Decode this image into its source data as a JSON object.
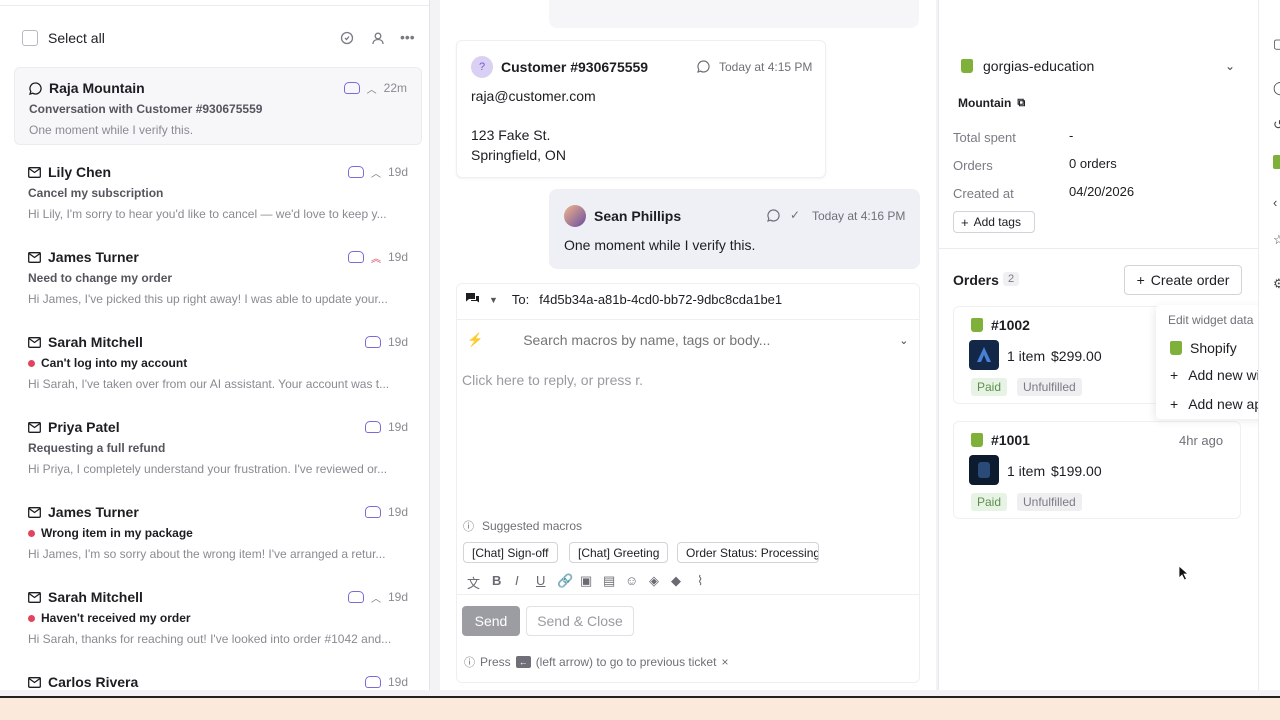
{
  "ticket_list": {
    "select_all_label": "Select all",
    "tickets": [
      {
        "name": "Raja Mountain",
        "subject": "Conversation with Customer #930675559",
        "preview": "One moment while I verify this.",
        "time": "22m",
        "urgent": false,
        "active": true,
        "channel": "chat",
        "priority": "up"
      },
      {
        "name": "Lily Chen",
        "subject": "Cancel my subscription",
        "preview": "Hi Lily, I'm sorry to hear you'd like to cancel — we'd love to keep y...",
        "time": "19d",
        "urgent": false,
        "channel": "email",
        "priority": "up"
      },
      {
        "name": "James Turner",
        "subject": "Need to change my order",
        "preview": "Hi James, I've picked this up right away! I was able to update your...",
        "time": "19d",
        "urgent": false,
        "channel": "email",
        "priority": "double-up"
      },
      {
        "name": "Sarah Mitchell",
        "subject": "Can't log into my account",
        "preview": "Hi Sarah, I've taken over from our AI assistant. Your account was t...",
        "time": "19d",
        "urgent": true,
        "channel": "email",
        "priority": ""
      },
      {
        "name": "Priya Patel",
        "subject": "Requesting a full refund",
        "preview": "Hi Priya, I completely understand your frustration. I've reviewed or...",
        "time": "19d",
        "urgent": false,
        "channel": "email",
        "priority": ""
      },
      {
        "name": "James Turner",
        "subject": "Wrong item in my package",
        "preview": "Hi James, I'm so sorry about the wrong item! I've arranged a retur...",
        "time": "19d",
        "urgent": true,
        "channel": "email",
        "priority": ""
      },
      {
        "name": "Sarah Mitchell",
        "subject": "Haven't received my order",
        "preview": "Hi Sarah, thanks for reaching out! I've looked into order #1042 and...",
        "time": "19d",
        "urgent": true,
        "channel": "email",
        "priority": "up"
      },
      {
        "name": "Carlos Rivera",
        "subject": "",
        "preview": "",
        "time": "19d",
        "urgent": false,
        "channel": "email",
        "priority": ""
      }
    ]
  },
  "conversation": {
    "customer_msg": {
      "avatar": "?",
      "sender": "Customer #930675559",
      "time": "Today at 4:15 PM",
      "line1": "raja@customer.com",
      "line2": "123 Fake St.",
      "line3": "Springfield, ON"
    },
    "agent_msg": {
      "sender": "Sean Phillips",
      "time": "Today at 4:16 PM",
      "text": "One moment while I verify this."
    }
  },
  "composer": {
    "to_label": "To:",
    "to_value": "f4d5b34a-a81b-4cd0-bb72-9dbc8cda1be1",
    "macro_placeholder": "Search macros by name, tags or body...",
    "reply_placeholder": "Click here to reply, or press r.",
    "suggested_label": "Suggested macros",
    "macros": [
      "[Chat] Sign-off",
      "[Chat] Greeting",
      "Order Status: Processing"
    ],
    "send_label": "Send",
    "send_close_label": "Send & Close",
    "hint_prefix": "Press",
    "hint_key": "←",
    "hint_suffix": "(left arrow) to go to previous ticket",
    "hint_close": "×"
  },
  "sidebar": {
    "store": "gorgias-education",
    "customer_name": "Mountain",
    "total_spent_label": "Total spent",
    "total_spent_value": "-",
    "orders_label": "Orders",
    "orders_value": "0 orders",
    "created_label": "Created at",
    "created_value": "04/20/2026",
    "add_tags_label": "Add tags",
    "orders_section_title": "Orders",
    "orders_count": "2",
    "create_order_label": "Create order",
    "orders": [
      {
        "number": "#1002",
        "items": "1 item",
        "price": "$299.00",
        "paid": "Paid",
        "fulfillment": "Unfulfilled",
        "time": ""
      },
      {
        "number": "#1001",
        "items": "1 item",
        "price": "$199.00",
        "paid": "Paid",
        "fulfillment": "Unfulfilled",
        "time": "4hr ago"
      }
    ],
    "widget_menu": {
      "title": "Edit widget data",
      "item1": "Shopify",
      "item2": "Add new widg",
      "item3": "Add new app"
    }
  },
  "colors": {
    "accent": "#7a6bd9",
    "urgent": "#e0455d",
    "shopify": "#7fb13a"
  }
}
